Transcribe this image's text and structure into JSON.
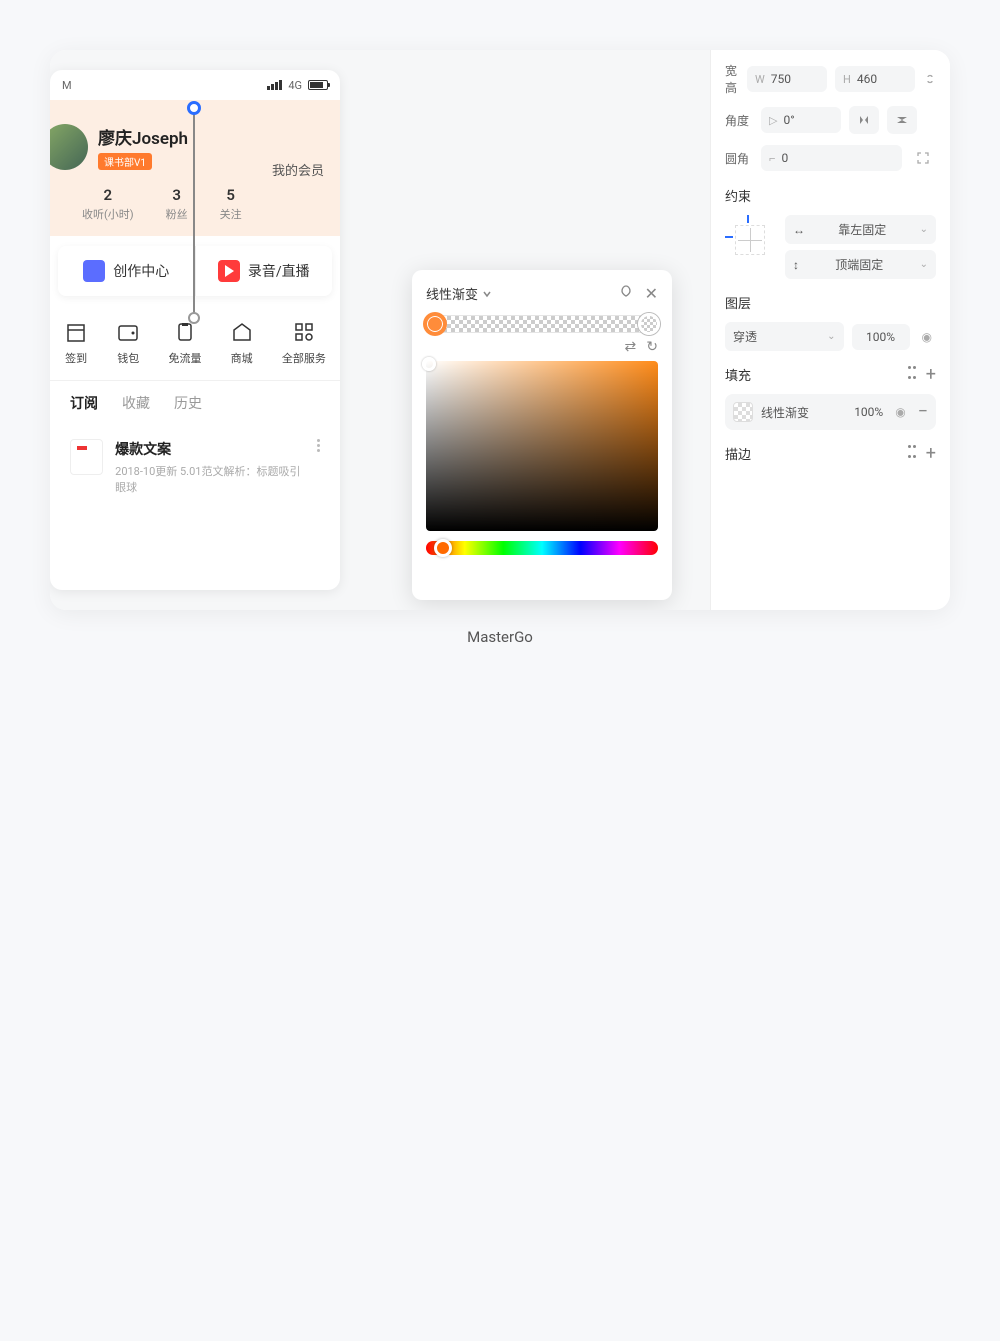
{
  "caption": "MasterGo",
  "mobile": {
    "time_label": "M",
    "network": "4G",
    "username": "廖庆Joseph",
    "badge": "课书部V1",
    "member_link": "我的会员",
    "stats": [
      {
        "num": "2",
        "label": "收听(小时)"
      },
      {
        "num": "3",
        "label": "粉丝"
      },
      {
        "num": "5",
        "label": "关注"
      }
    ],
    "actions": [
      {
        "label": "创作中心"
      },
      {
        "label": "录音/直播"
      }
    ],
    "services": [
      {
        "label": "签到"
      },
      {
        "label": "钱包"
      },
      {
        "label": "免流量"
      },
      {
        "label": "商城"
      },
      {
        "label": "全部服务"
      }
    ],
    "tabs": [
      {
        "label": "订阅"
      },
      {
        "label": "收藏"
      },
      {
        "label": "历史"
      }
    ],
    "list_item": {
      "title": "爆款文案",
      "sub": "2018-10更新 5.01范文解析：标题吸引眼球"
    }
  },
  "color_picker": {
    "title": "线性渐变"
  },
  "props": {
    "size_label": "宽高",
    "width_letter": "W",
    "width": "750",
    "height_letter": "H",
    "height": "460",
    "angle_label": "角度",
    "angle_value": "0°",
    "radius_label": "圆角",
    "radius_value": "0",
    "constraint_label": "约束",
    "constraint_h": "靠左固定",
    "constraint_v": "顶端固定",
    "layer_label": "图层",
    "blend_mode": "穿透",
    "opacity": "100%",
    "fill_label": "填充",
    "fill_type": "线性渐变",
    "fill_opacity": "100%",
    "stroke_label": "描边"
  }
}
